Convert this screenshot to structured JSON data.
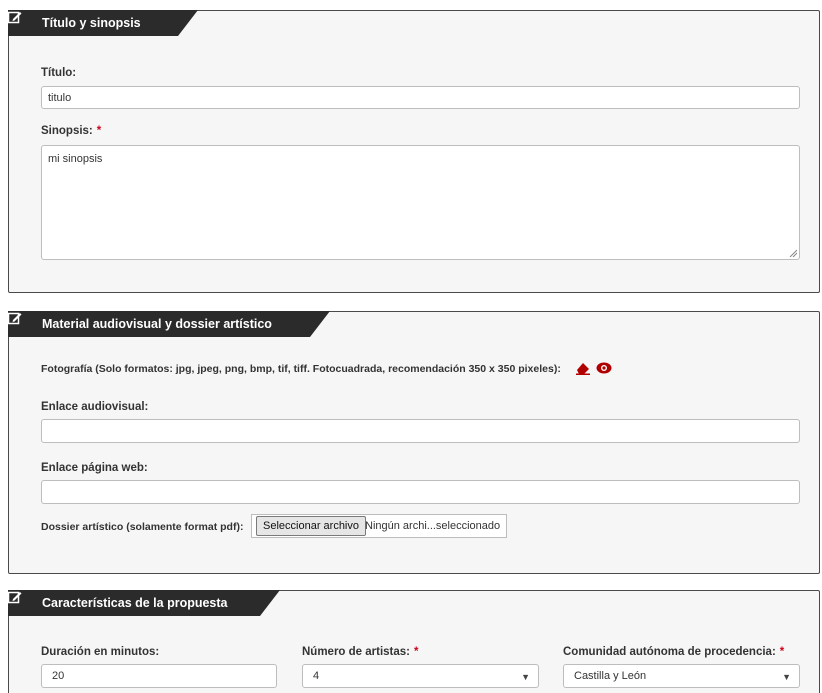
{
  "section1": {
    "title": "Título y sinopsis",
    "titulo_label": "Título:",
    "titulo_value": "titulo",
    "sinopsis_label": "Sinopsis:",
    "sinopsis_required": "*",
    "sinopsis_value": "mi sinopsis"
  },
  "section2": {
    "title": "Material audiovisual y dossier artístico",
    "foto_label": "Fotografía (Solo formatos: jpg, jpeg, png, bmp, tif, tiff. Fotocuadrada, recomendación 350 x 350 pixeles):",
    "enlace_av_label": "Enlace audiovisual:",
    "enlace_av_value": "",
    "enlace_web_label": "Enlace página web:",
    "enlace_web_value": "",
    "dossier_label": "Dossier artístico (solamente format pdf):",
    "file_button": "Seleccionar archivo",
    "file_status": "Ningún archi...seleccionado"
  },
  "section3": {
    "title": "Características de la propuesta",
    "duracion_label": "Duración en minutos:",
    "duracion_value": "20",
    "artistas_label": "Número de artistas:",
    "artistas_required": "*",
    "artistas_value": "4",
    "comunidad_label": "Comunidad autónoma de procedencia:",
    "comunidad_required": "*",
    "comunidad_value": "Castilla y León"
  },
  "colors": {
    "header_bg": "#2b2b2b",
    "required": "#d0021b",
    "icon_red": "#b00000"
  },
  "icons": {
    "header": "edit-icon",
    "foto_delete": "eraser-icon",
    "foto_view": "eye-icon",
    "select": "caret-down-icon"
  }
}
